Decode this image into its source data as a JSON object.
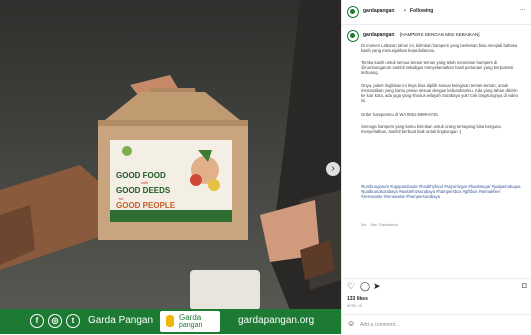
{
  "post_image": {
    "box_print": {
      "line1": "GOOD FOOD",
      "line2": "with",
      "line3": "GOOD DEEDS",
      "line4": "for",
      "line5": "GOOD PEOPLE"
    },
    "footer": {
      "social_icons": [
        "facebook-icon",
        "instagram-icon",
        "twitter-icon"
      ],
      "brand": "Garda Pangan",
      "logo_text_1": "Garda",
      "logo_text_2": "pangan",
      "website": "gardapangan.org"
    },
    "colors": {
      "footer_green": "#1d7a33"
    }
  },
  "header": {
    "username": "gardapangan",
    "separator": "•",
    "follow_status": "Following",
    "more": "..."
  },
  "caption": {
    "username": "gardapangan",
    "title": "[HAMPERS DENGAN MISI KEBAIKAN]",
    "p1": "Di momen Lebaran tahun ini, kirimkan hampers yang berkesan bisa menjadi bahasa kasih yang menunjukkan kepedulianmu.",
    "p2": "Temka kasih untuk semua teman-teman yang telah memesan hampers di @rumbungarum sambil sekaligus menyelamatkan hasil pertanian yang berpotensi terbuang.",
    "p3": "Onya, paket tingkisan ini tinya bisa dipilih sesuai keinginan teman-teman, untuk memastikan yang kamu pesan sesuai dengan kebutuhanmu. Ada yang tahan dikirim ke luar kota, ada juga yang khusus wilayah Surabaya yuk! Cek langsungnya di video ini.",
    "p4": "Order hampersnu di WA 0851-5999-6745",
    "p5": "Semoga hampers yang kamu kirimkan untuk orang tersayang bisa berguna, menyehatkan, sambil berbuat baik untuk lingkungan :)",
    "hashtags": "#lumbungarum #ugspandoude #healthyfood #sayursegar #buahsegar #jualperoduqua #jualbrandsurabaya #wastefrizsurabaya #hampersbox #giftbox #semakhier #zerowaste #zerowaste #hampersurabaya",
    "time": "3w",
    "see_translation": "See Translation"
  },
  "actions": {
    "likes": "133 likes",
    "date": "APRIL 15",
    "comment_placeholder": "Add a comment..."
  }
}
